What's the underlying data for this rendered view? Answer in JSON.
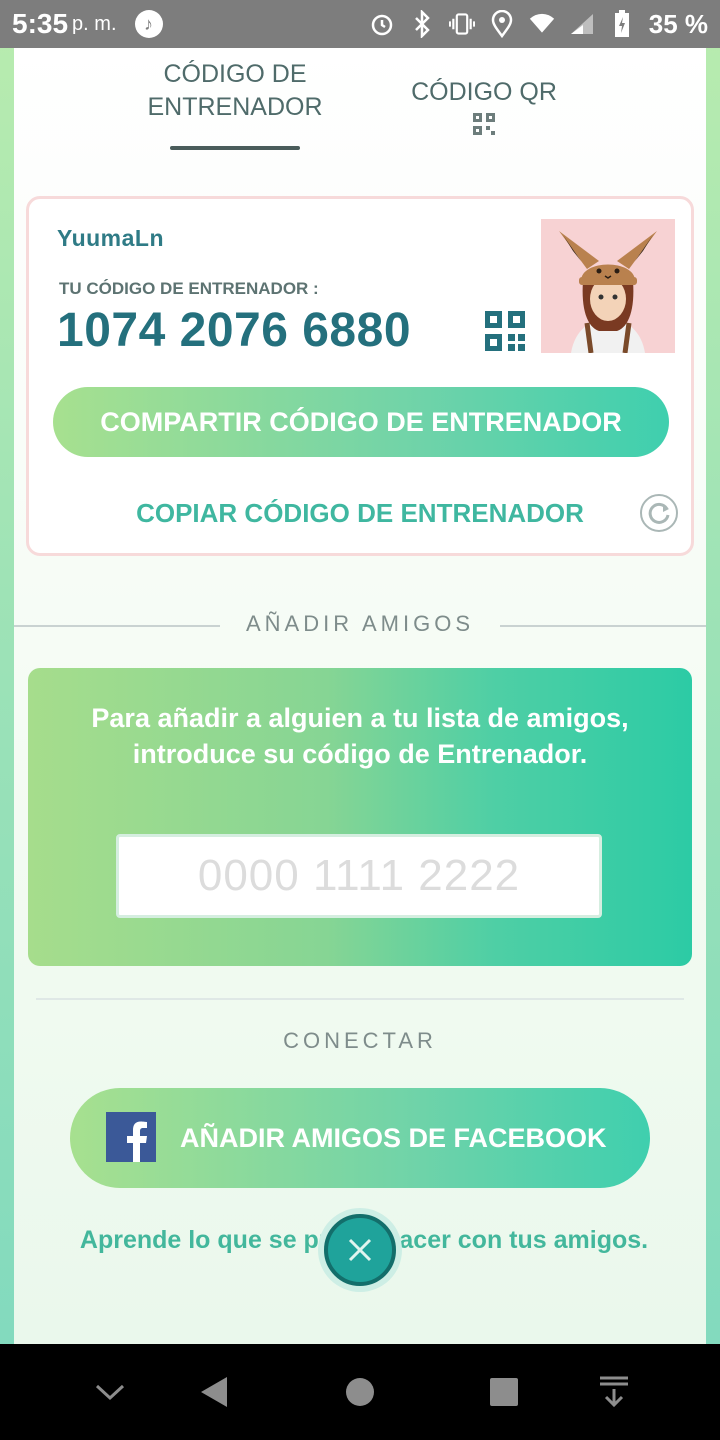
{
  "status_bar": {
    "time": "5:35",
    "ampm": "p. m.",
    "battery_percent": "35 %"
  },
  "tabs": [
    {
      "label": "CÓDIGO DE ENTRENADOR",
      "active": true
    },
    {
      "label": "CÓDIGO QR",
      "active": false
    }
  ],
  "trainer_card": {
    "username": "YuumaLn",
    "code_label": "TU CÓDIGO DE ENTRENADOR :",
    "code_value": "1074 2076 6880",
    "share_button": "COMPARTIR CÓDIGO DE ENTRENADOR",
    "copy_button": "COPIAR CÓDIGO DE ENTRENADOR"
  },
  "add_friends": {
    "section_label": "AÑADIR AMIGOS",
    "instructions": "Para añadir a alguien a tu lista de amigos, introduce su código de Entrenador.",
    "input_placeholder": "0000 1111 2222",
    "input_value": ""
  },
  "connect": {
    "section_label": "CONECTAR",
    "facebook_button": "AÑADIR AMIGOS DE FACEBOOK",
    "learn_link": "Aprende lo que se puede hacer con tus amigos."
  },
  "colors": {
    "accent_teal": "#24707d",
    "button_gradient_start": "#a7e08f",
    "button_gradient_end": "#3fcfae",
    "facebook_blue": "#3b5998"
  },
  "icons": {
    "music": "music-note-icon",
    "alarm": "alarm-icon",
    "bluetooth": "bluetooth-icon",
    "vibrate": "vibrate-icon",
    "location": "location-icon",
    "wifi": "wifi-icon",
    "signal": "signal-icon",
    "battery": "battery-charging-icon"
  }
}
